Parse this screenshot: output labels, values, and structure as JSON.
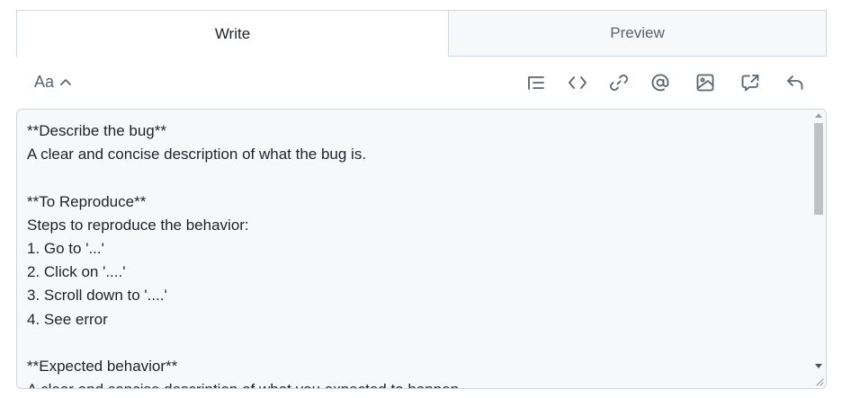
{
  "tabs": {
    "write_label": "Write",
    "preview_label": "Preview",
    "active": "write"
  },
  "toolbar": {
    "text_size_label": "Aa",
    "buttons": [
      {
        "icon": "heading-list-icon"
      },
      {
        "icon": "code-icon"
      },
      {
        "icon": "link-icon"
      },
      {
        "icon": "mention-icon"
      },
      {
        "icon": "image-icon"
      },
      {
        "icon": "cross-reference-icon"
      },
      {
        "icon": "reply-icon"
      }
    ]
  },
  "editor": {
    "value": "**Describe the bug**\nA clear and concise description of what the bug is.\n\n**To Reproduce**\nSteps to reproduce the behavior:\n1. Go to '...'\n2. Click on '....'\n3. Scroll down to '....'\n4. See error\n\n**Expected behavior**\nA clear and concise description of what you expected to happen."
  },
  "colors": {
    "border": "#d0d7de",
    "editor_bg": "#f6f8fa",
    "icon": "#59636e",
    "text": "#1f2328"
  }
}
